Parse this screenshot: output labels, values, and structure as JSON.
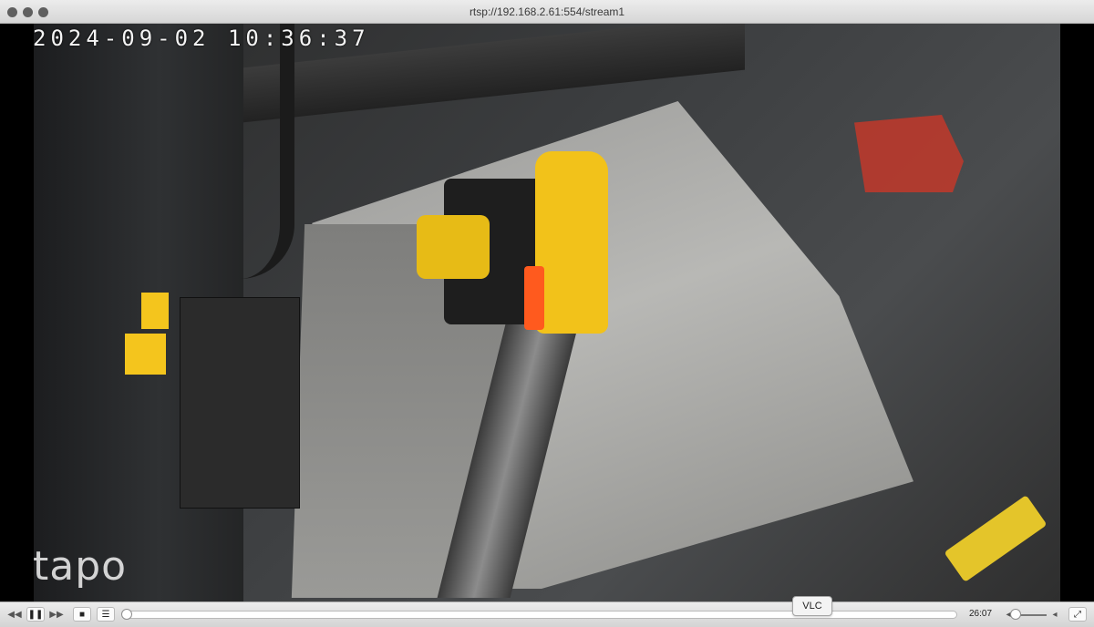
{
  "window": {
    "title": "rtsp://192.168.2.61:554/stream1"
  },
  "video": {
    "timestamp_overlay": "2024-09-02 10:36:37",
    "watermark": "tapo"
  },
  "controls": {
    "rewind_icon": "rewind-icon",
    "play_pause_icon": "pause-icon",
    "forward_icon": "fast-forward-icon",
    "stop_icon": "stop-icon",
    "playlist_icon": "playlist-icon",
    "tooltip": "VLC",
    "time": "26:07",
    "fullscreen_icon": "fullscreen-icon",
    "playback_progress": 0.0
  }
}
